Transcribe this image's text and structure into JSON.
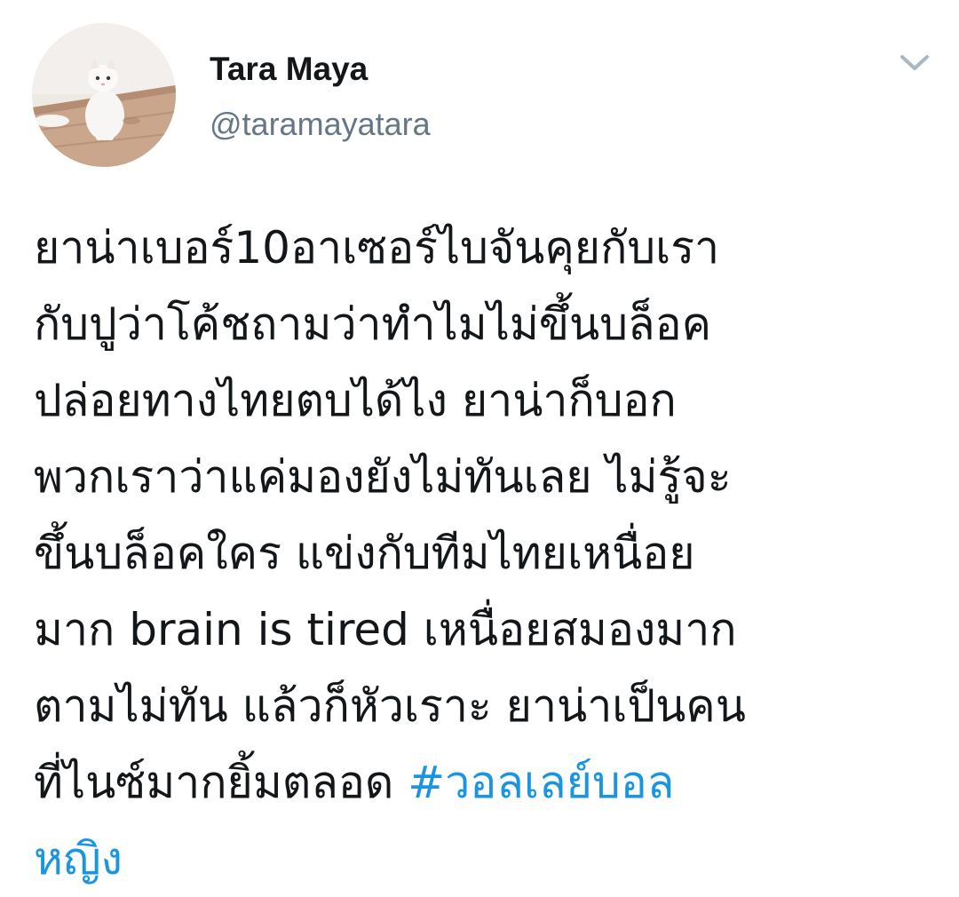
{
  "author": {
    "display_name": "Tara Maya",
    "handle": "@taramayatara",
    "avatar_icon": "cat-photo-avatar"
  },
  "menu": {
    "icon": "chevron-down-icon",
    "color": "#aab8c2"
  },
  "tweet": {
    "lines": [
      "ยาน่าเบอร์10อาเซอร์ไบจันคุยกับเรา",
      "กับปูว่าโค้ชถามว่าทำไมไม่ขึ้นบล็อค",
      "ปล่อยทางไทยตบได้ไง ยาน่าก็บอก",
      "พวกเราว่าแค่มองยังไม่ทันเลย ไม่รู้จะ",
      "ขึ้นบล็อคใคร แข่งกับทีมไทยเหนื่อย",
      "มาก brain is tired เหนื่อยสมองมาก",
      "ตามไม่ทัน แล้วก็หัวเราะ ยาน่าเป็นคน"
    ],
    "last_line_text": "ที่ไนซ์มากยิ้มตลอด ",
    "hashtag_part1": "#วอลเลย์บอล",
    "hashtag_part2": "หญิง"
  },
  "colors": {
    "text": "#14171a",
    "secondary": "#657786",
    "link": "#1b95e0",
    "background": "#ffffff"
  }
}
